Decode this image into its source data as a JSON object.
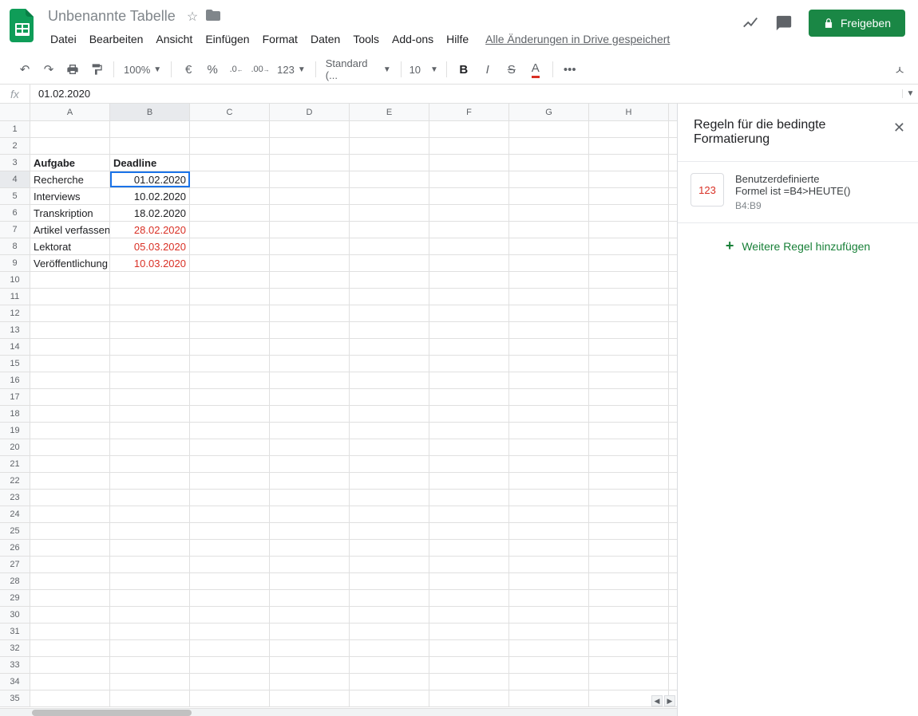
{
  "doc": {
    "title": "Unbenannte Tabelle"
  },
  "menus": [
    "Datei",
    "Bearbeiten",
    "Ansicht",
    "Einfügen",
    "Format",
    "Daten",
    "Tools",
    "Add-ons",
    "Hilfe"
  ],
  "drive_status": "Alle Änderungen in Drive gespeichert",
  "share_button": "Freigeben",
  "toolbar": {
    "zoom": "100%",
    "currency": "€",
    "percent": "%",
    "dec_less": ".0",
    "dec_more": ".00",
    "format123": "123",
    "font": "Standard (...",
    "font_size": "10",
    "more": "•••"
  },
  "formula": {
    "fx": "fx",
    "value": "01.02.2020"
  },
  "columns": [
    "A",
    "B",
    "C",
    "D",
    "E",
    "F",
    "G",
    "H"
  ],
  "total_rows": 35,
  "selection": {
    "col": "B",
    "row": 4
  },
  "cells": {
    "A3": {
      "v": "Aufgabe",
      "bold": true
    },
    "B3": {
      "v": "Deadline",
      "bold": true
    },
    "A4": {
      "v": "Recherche"
    },
    "B4": {
      "v": "01.02.2020",
      "right": true
    },
    "A5": {
      "v": "Interviews"
    },
    "B5": {
      "v": "10.02.2020",
      "right": true
    },
    "A6": {
      "v": "Transkription"
    },
    "B6": {
      "v": "18.02.2020",
      "right": true
    },
    "A7": {
      "v": "Artikel verfassen"
    },
    "B7": {
      "v": "28.02.2020",
      "right": true,
      "red": true
    },
    "A8": {
      "v": "Lektorat"
    },
    "B8": {
      "v": "05.03.2020",
      "right": true,
      "red": true
    },
    "A9": {
      "v": "Veröffentlichung"
    },
    "B9": {
      "v": "10.03.2020",
      "right": true,
      "red": true
    }
  },
  "sidebar": {
    "title": "Regeln für die bedingte Formatierung",
    "rule_swatch": "123",
    "rule_line1": "Benutzerdefinierte",
    "rule_line2": "Formel ist =B4>HEUTE()",
    "rule_range": "B4:B9",
    "add_rule": "Weitere Regel hinzufügen"
  }
}
